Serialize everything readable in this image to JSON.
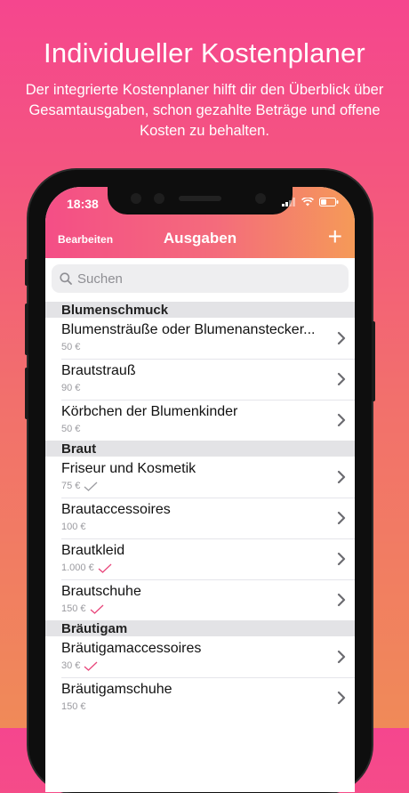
{
  "headline": "Individueller Kostenplaner",
  "subline": "Der integrierte Kostenplaner hilft dir den Überblick über Gesamtausgaben, schon gezahlte Beträge und offene Kosten zu behalten.",
  "status": {
    "time": "18:38"
  },
  "nav": {
    "edit_label": "Bearbeiten",
    "title": "Ausgaben",
    "add_label": "+"
  },
  "search": {
    "placeholder": "Suchen"
  },
  "sections": [
    {
      "title": "Blumenschmuck",
      "items": [
        {
          "name": "Blumensträuße oder Blumenanstecker...",
          "amount": "50 €",
          "paid": false
        },
        {
          "name": "Brautstrauß",
          "amount": "90 €",
          "paid": false
        },
        {
          "name": "Körbchen der Blumenkinder",
          "amount": "50 €",
          "paid": false
        }
      ]
    },
    {
      "title": "Braut",
      "items": [
        {
          "name": "Friseur und Kosmetik",
          "amount": "75 €",
          "paid": true
        },
        {
          "name": "Brautaccessoires",
          "amount": "100 €",
          "paid": false
        },
        {
          "name": "Brautkleid",
          "amount": "1.000 €",
          "paid": true
        },
        {
          "name": "Brautschuhe",
          "amount": "150 €",
          "paid": true
        }
      ]
    },
    {
      "title": "Bräutigam",
      "items": [
        {
          "name": "Bräutigamaccessoires",
          "amount": "30 €",
          "paid": true
        },
        {
          "name": "Bräutigamschuhe",
          "amount": "150 €",
          "paid": false
        }
      ]
    }
  ],
  "colors": {
    "accent_pink": "#f44e86",
    "accent_orange": "#f59a58",
    "check_color": "#e8457a"
  }
}
